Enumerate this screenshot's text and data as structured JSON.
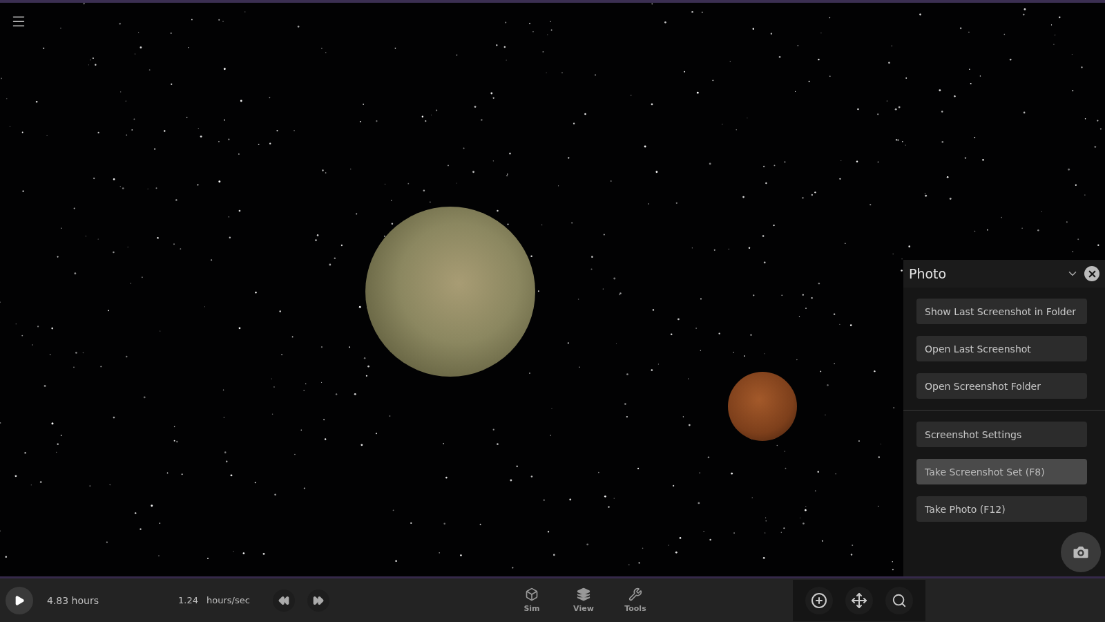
{
  "panel": {
    "title": "Photo",
    "groups": [
      {
        "buttons": [
          {
            "label": "Show Last Screenshot in Folder",
            "highlighted": false
          },
          {
            "label": "Open Last Screenshot",
            "highlighted": false
          },
          {
            "label": "Open Screenshot Folder",
            "highlighted": false
          }
        ]
      },
      {
        "buttons": [
          {
            "label": "Screenshot Settings",
            "highlighted": false
          },
          {
            "label": "Take Screenshot Set (F8)",
            "highlighted": true
          },
          {
            "label": "Take Photo (F12)",
            "highlighted": false
          }
        ]
      }
    ]
  },
  "time_bar": {
    "elapsed": "4.83 hours",
    "rate_value": "1.24",
    "rate_unit": "hours/sec"
  },
  "nav_tabs": [
    {
      "label": "Sim",
      "kind": "cube"
    },
    {
      "label": "View",
      "kind": "layers"
    },
    {
      "label": "Tools",
      "kind": "wrench"
    }
  ]
}
